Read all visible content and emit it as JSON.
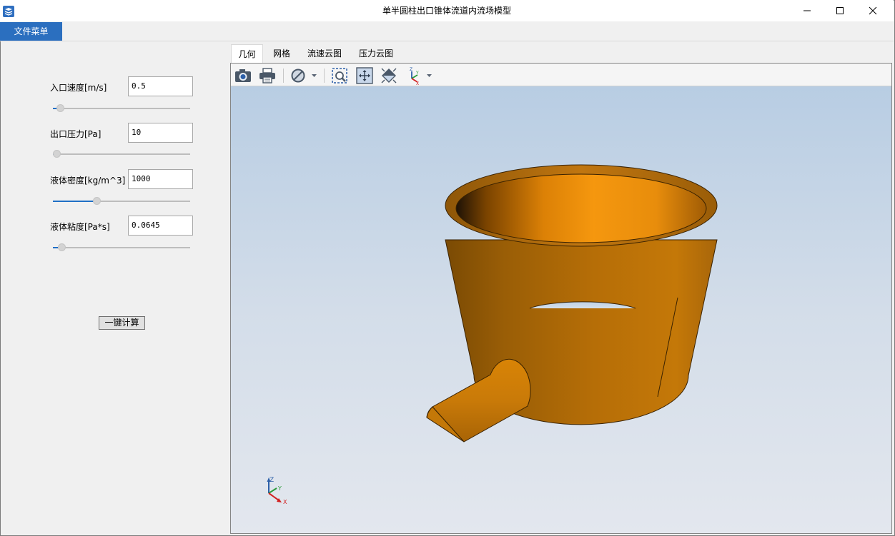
{
  "window": {
    "title": "单半圆柱出口锥体流道内流场模型",
    "controls": {
      "minimize": "minimize-icon",
      "maximize": "maximize-icon",
      "close": "close-icon"
    }
  },
  "menu": {
    "file": "文件菜单"
  },
  "params": [
    {
      "label": "入口速度[m/s]",
      "value": "0.5",
      "slider_fraction": 0.03
    },
    {
      "label": "出口压力[Pa]",
      "value": "10",
      "slider_fraction": 0.0
    },
    {
      "label": "液体密度[kg/m^3]",
      "value": "1000",
      "slider_fraction": 0.31
    },
    {
      "label": "液体粘度[Pa*s]",
      "value": "0.0645",
      "slider_fraction": 0.04
    }
  ],
  "calc_button": "一键计算",
  "tabs": [
    "几何",
    "网格",
    "流速云图",
    "压力云图"
  ],
  "active_tab": "几何",
  "toolbar_icons": [
    "camera-icon",
    "print-icon",
    "display-mode-icon",
    "zoom-window-icon",
    "fit-all-icon",
    "view-orientation-icon",
    "axes-icon"
  ],
  "axes": {
    "z": "Z",
    "y": "Y",
    "x": "X"
  },
  "colors": {
    "accent": "#2b6fbf",
    "model": "#e08a12",
    "background_top": "#b8cde3",
    "background_bottom": "#e3e7ee"
  }
}
